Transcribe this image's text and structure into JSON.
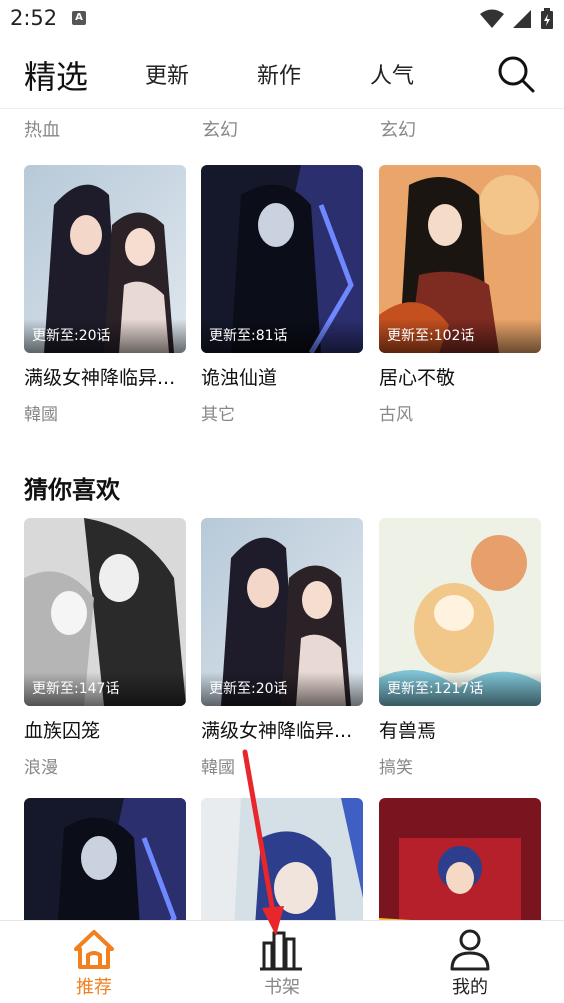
{
  "status_bar": {
    "time": "2:52",
    "notif_letter": "A"
  },
  "top_nav": {
    "title": "精选",
    "tabs": [
      "更新",
      "新作",
      "人气"
    ]
  },
  "top_tags": [
    "热血",
    "玄幻",
    "玄幻"
  ],
  "row1": [
    {
      "badge": "更新至:20话",
      "title": "满级女神降临异...",
      "genre": "韓國"
    },
    {
      "badge": "更新至:81话",
      "title": "诡浊仙道",
      "genre": "其它"
    },
    {
      "badge": "更新至:102话",
      "title": "居心不敬",
      "genre": "古风"
    }
  ],
  "guess_section": {
    "title": "猜你喜欢"
  },
  "row2": [
    {
      "badge": "更新至:147话",
      "title": "血族囚笼",
      "genre": "浪漫"
    },
    {
      "badge": "更新至:20话",
      "title": "满级女神降临异...",
      "genre": "韓國"
    },
    {
      "badge": "更新至:1217话",
      "title": "有兽焉",
      "genre": "搞笑"
    }
  ],
  "bottom_nav": {
    "items": [
      {
        "label": "推荐",
        "active": true
      },
      {
        "label": "书架",
        "active": false
      },
      {
        "label": "我的",
        "active": false
      }
    ]
  },
  "colors": {
    "accent": "#F2801E",
    "annotation": "#E8262B"
  }
}
